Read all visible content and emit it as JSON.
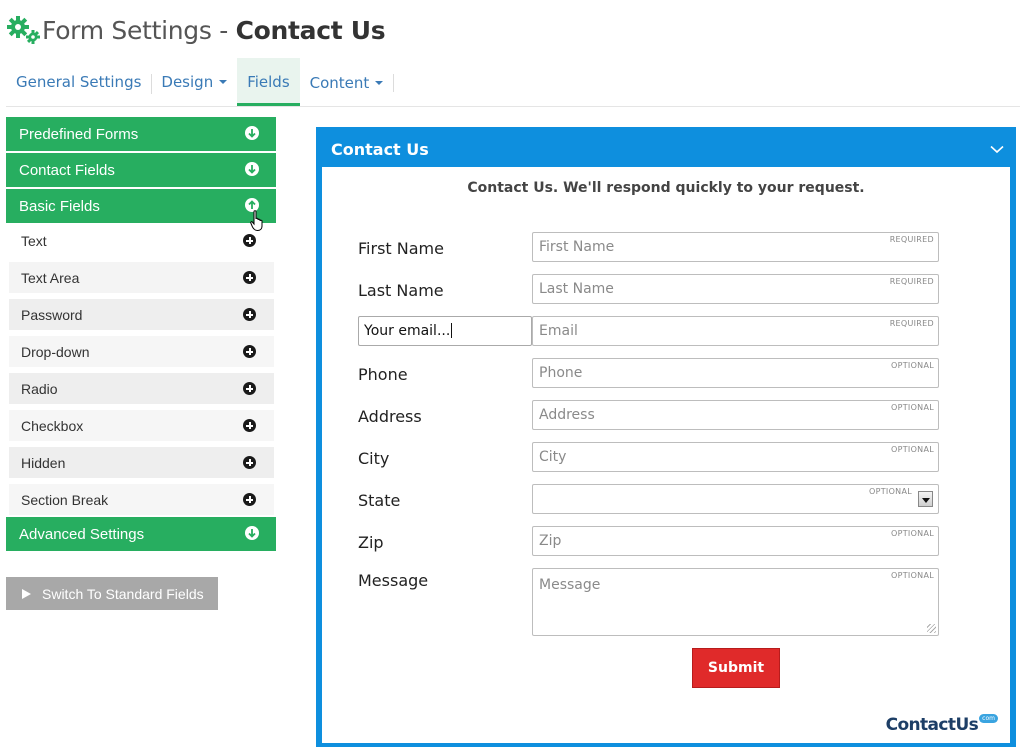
{
  "header": {
    "title_prefix": "Form Settings",
    "title_sep": " - ",
    "title_name": "Contact Us"
  },
  "tabs": [
    {
      "label": "General Settings",
      "dropdown": false,
      "active": false
    },
    {
      "label": "Design",
      "dropdown": true,
      "active": false
    },
    {
      "label": "Fields",
      "dropdown": false,
      "active": true
    },
    {
      "label": "Content",
      "dropdown": true,
      "active": false
    }
  ],
  "sidebar": {
    "sections": {
      "predefined": "Predefined Forms",
      "contact": "Contact Fields",
      "basic": "Basic Fields",
      "advanced": "Advanced Settings"
    },
    "basic_items": [
      "Text",
      "Text Area",
      "Password",
      "Drop-down",
      "Radio",
      "Checkbox",
      "Hidden",
      "Section Break"
    ],
    "switch_label": "Switch To Standard Fields"
  },
  "form": {
    "panel_title": "Contact Us",
    "heading": "Contact Us. We'll respond quickly to your request.",
    "fields": [
      {
        "label": "First Name",
        "placeholder": "First Name",
        "tag": "REQUIRED"
      },
      {
        "label": "Last Name",
        "placeholder": "Last Name",
        "tag": "REQUIRED"
      },
      {
        "label": "Your email...",
        "placeholder": "Email",
        "tag": "REQUIRED"
      },
      {
        "label": "Phone",
        "placeholder": "Phone",
        "tag": "OPTIONAL"
      },
      {
        "label": "Address",
        "placeholder": "Address",
        "tag": "OPTIONAL"
      },
      {
        "label": "City",
        "placeholder": "City",
        "tag": "OPTIONAL"
      },
      {
        "label": "State",
        "placeholder": "",
        "tag": "OPTIONAL"
      },
      {
        "label": "Zip",
        "placeholder": "Zip",
        "tag": "OPTIONAL"
      },
      {
        "label": "Message",
        "placeholder": "Message",
        "tag": "OPTIONAL"
      }
    ],
    "submit_label": "Submit"
  },
  "brand": {
    "name": "ContactUs",
    "suffix": "com"
  },
  "colors": {
    "green": "#27ae60",
    "blue": "#0e8fde",
    "red": "#e02a2a",
    "link": "#3a7ab6"
  }
}
